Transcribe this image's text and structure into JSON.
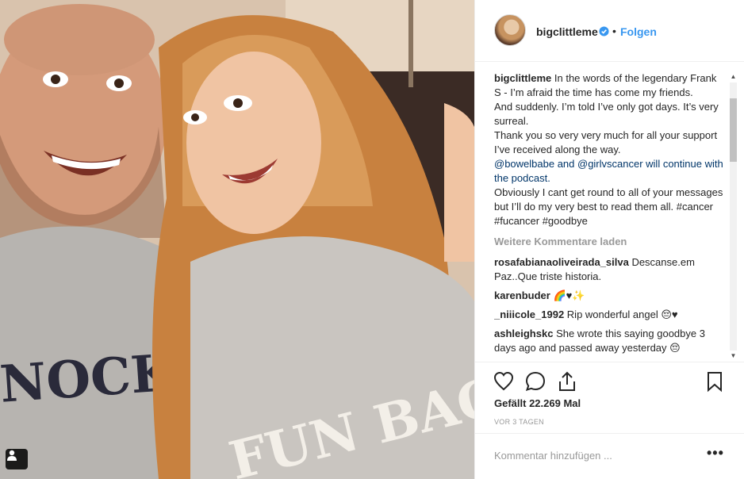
{
  "header": {
    "username": "bigclittleme",
    "separator": "•",
    "follow_label": "Folgen"
  },
  "photo": {
    "shirt_left_text": "NOCK R",
    "shirt_right_text": "FUN BAG",
    "tag_icon": "person-tag-icon"
  },
  "caption": {
    "username": "bigclittleme",
    "lines": [
      "In the words of the legendary Frank S - I’m afraid the time has come my friends.",
      "And suddenly. I’m told I’ve only got days. It’s very surreal.",
      "Thank you so very very much for all your support I’ve received along the way.",
      "@bowelbabe and @girlvscancer will continue with the podcast.",
      "Obviously I cant get round to all of your messages but I’ll do my very best to read them all. #cancer #fucancer #goodbye"
    ]
  },
  "load_more": "Weitere Kommentare laden",
  "comments": [
    {
      "user": "rosafabianaoliveirada_silva",
      "text": "Descanse.em Paz..Que triste historia."
    },
    {
      "user": "karenbuder",
      "text": "🌈♥✨"
    },
    {
      "user": "_niiicole_1992",
      "text": "Rip wonderful angel 😔♥"
    },
    {
      "user": "ashleighskc",
      "text": "She wrote this saying goodbye 3 days ago and passed away yesterday 😔"
    }
  ],
  "actions": {
    "like_icon": "heart-icon",
    "comment_icon": "comment-bubble-icon",
    "share_icon": "share-icon",
    "save_icon": "bookmark-icon",
    "likes_text": "Gefällt 22.269 Mal",
    "time_text": "VOR 3 TAGEN"
  },
  "add_comment": {
    "placeholder": "Kommentar hinzufügen ...",
    "more_label": "•••"
  },
  "colors": {
    "accent": "#3897f0",
    "text": "#262626",
    "muted": "#999999",
    "border": "#efefef"
  }
}
